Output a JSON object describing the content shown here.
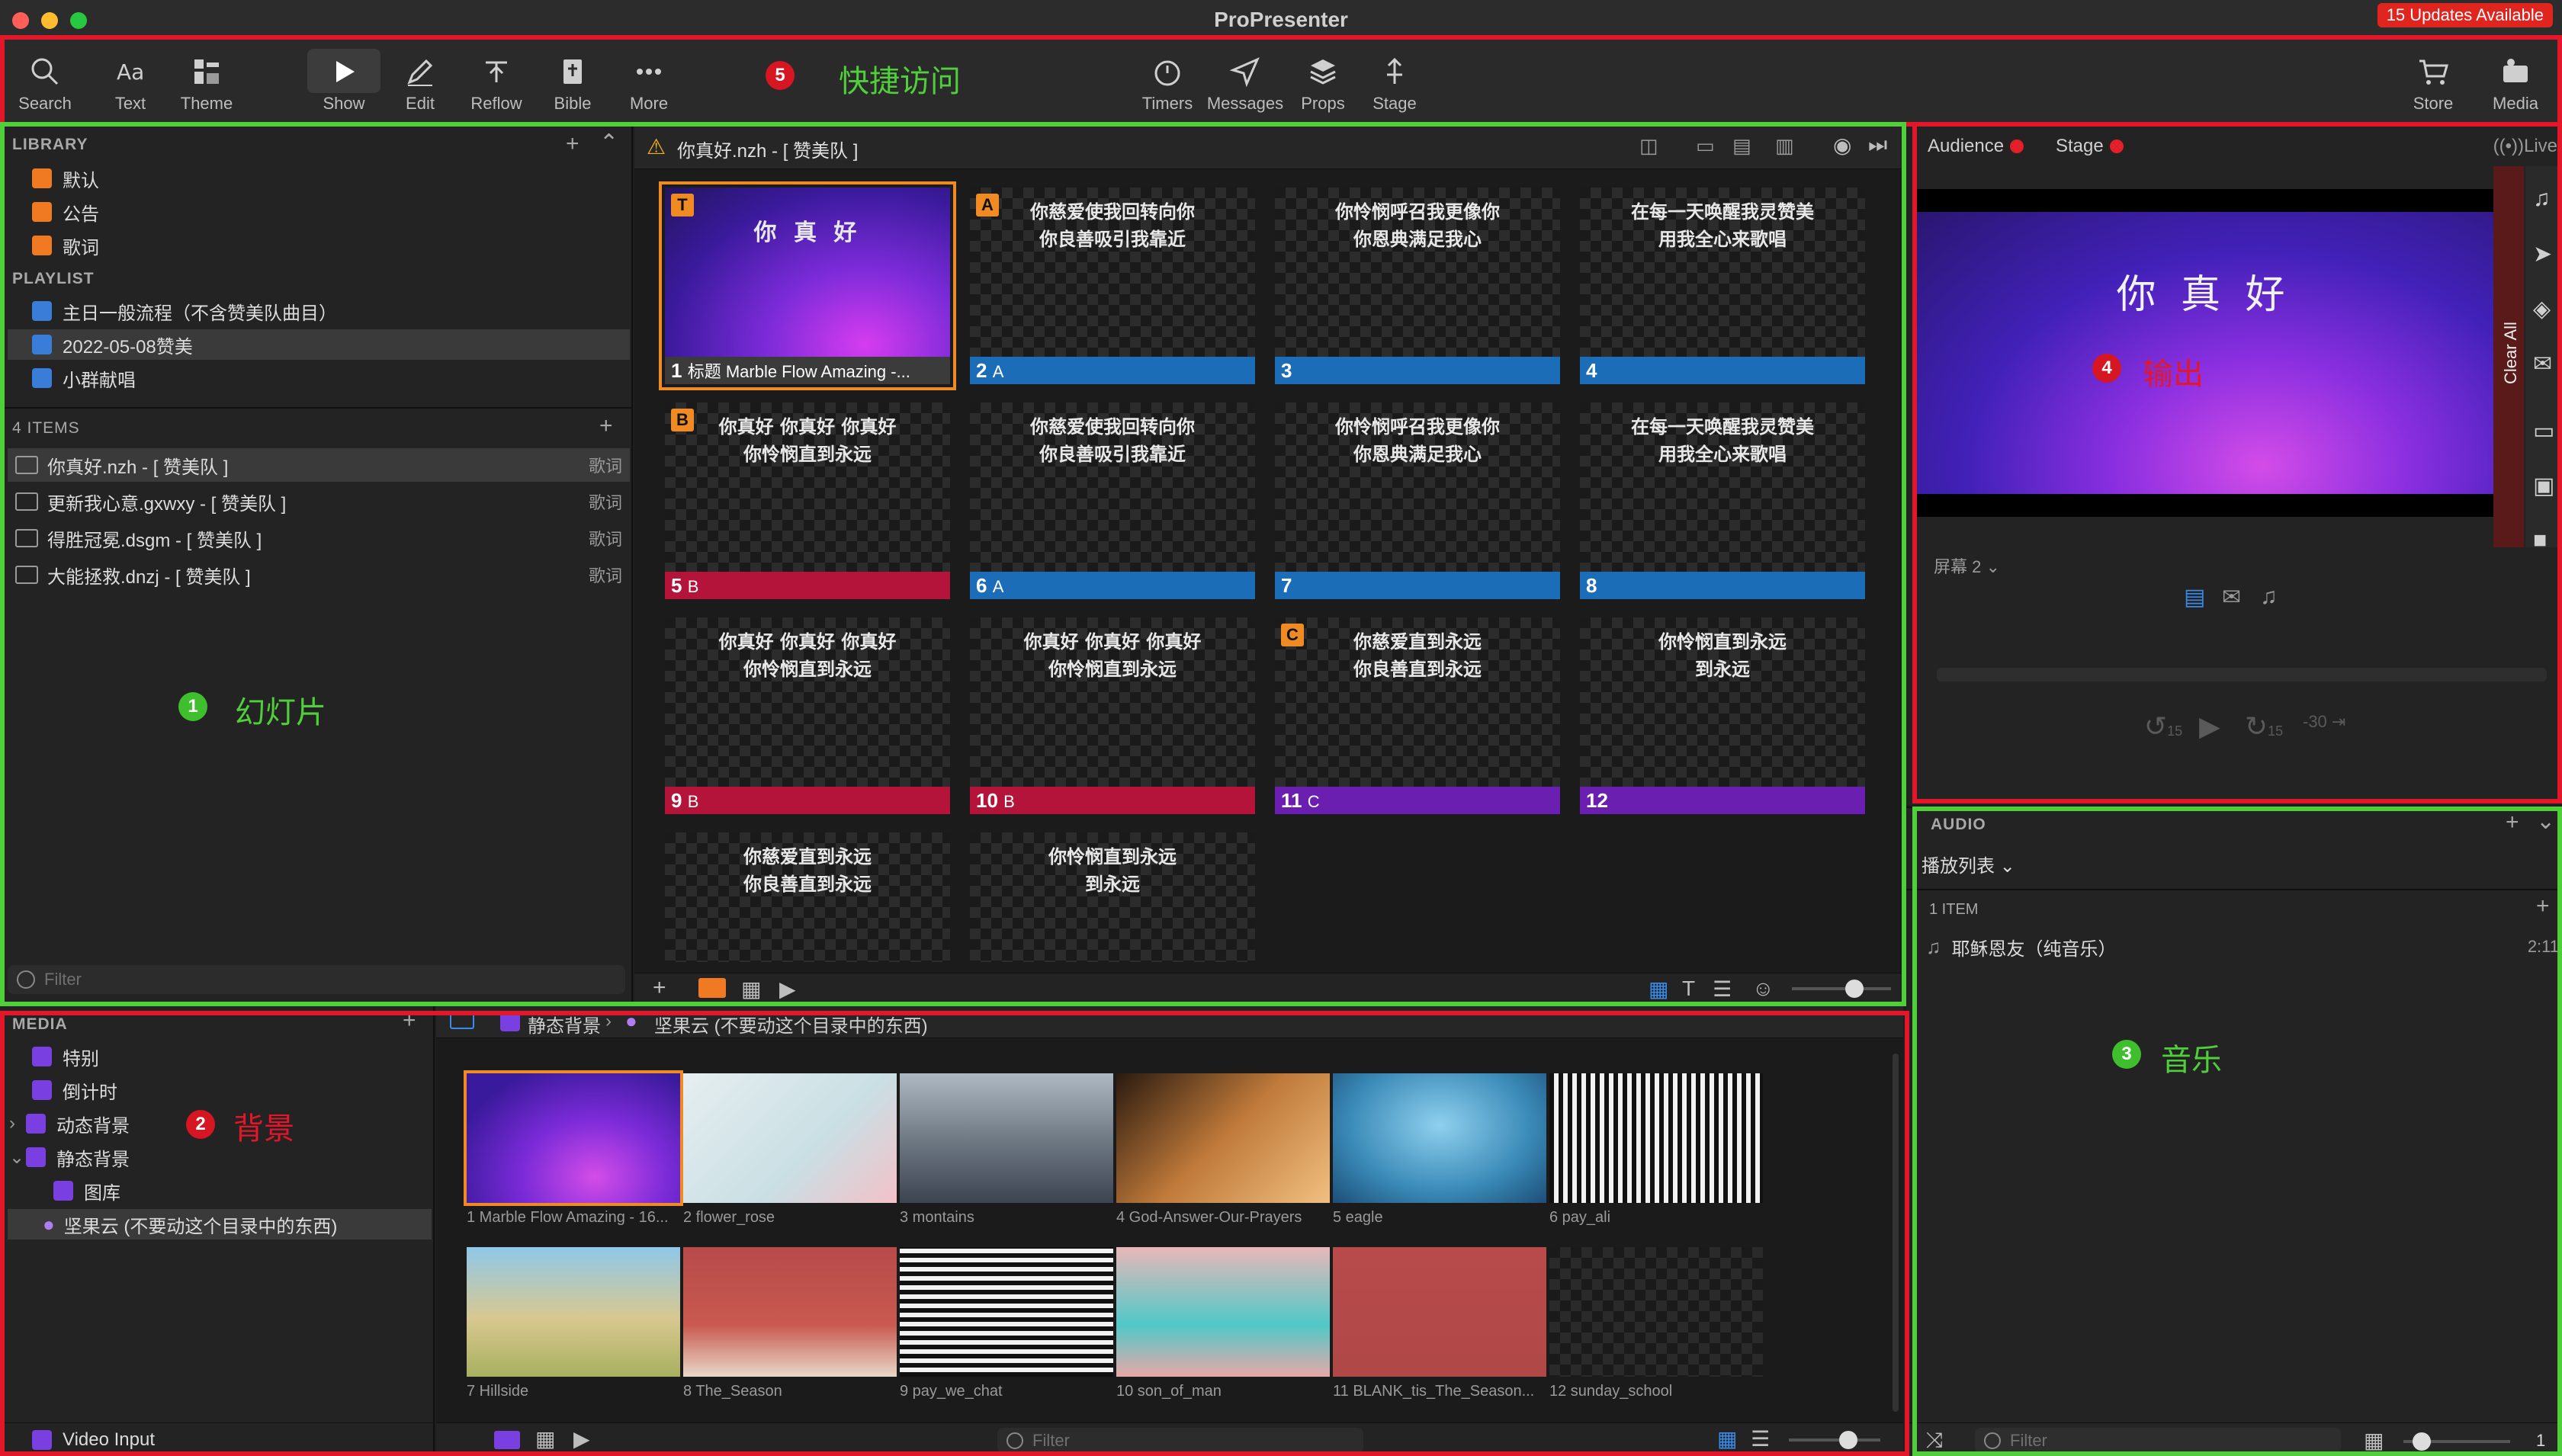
{
  "window": {
    "title": "ProPresenter",
    "updates": "15 Updates Available"
  },
  "toolbar": {
    "left": [
      "Search",
      "Text",
      "Theme"
    ],
    "center": [
      "Show",
      "Edit",
      "Reflow",
      "Bible",
      "More"
    ],
    "right": [
      "Timers",
      "Messages",
      "Props",
      "Stage"
    ],
    "far_right": [
      "Store",
      "Media"
    ]
  },
  "annotations": {
    "a1": {
      "num": "1",
      "label": "幻灯片"
    },
    "a2": {
      "num": "2",
      "label": "背景"
    },
    "a3": {
      "num": "3",
      "label": "音乐"
    },
    "a4": {
      "num": "4",
      "label": "输出"
    },
    "a5": {
      "num": "5",
      "label": "快捷访问"
    }
  },
  "library": {
    "header": "LIBRARY",
    "items": [
      "默认",
      "公告",
      "歌词"
    ],
    "playlist_header": "PLAYLIST",
    "playlists": [
      "主日一般流程（不含赞美队曲目）",
      "2022-05-08赞美",
      "小群献唱"
    ]
  },
  "items": {
    "count": "4 ITEMS",
    "rows": [
      {
        "name": "你真好.nzh - [ 赞美队 ]",
        "tag": "歌词"
      },
      {
        "name": "更新我心意.gxwxy - [ 赞美队 ]",
        "tag": "歌词"
      },
      {
        "name": "得胜冠冕.dsgm - [ 赞美队 ]",
        "tag": "歌词"
      },
      {
        "name": "大能拯救.dnzj - [ 赞美队 ]",
        "tag": "歌词"
      }
    ],
    "filter": "Filter"
  },
  "presentation": {
    "title": "你真好.nzh - [ 赞美队 ]",
    "slides": [
      {
        "l1": "你 真 好",
        "l2": "",
        "num": "1",
        "label": "标题 Marble Flow Amazing -...",
        "group": "T"
      },
      {
        "l1": "你慈爱使我回转向你",
        "l2": "你良善吸引我靠近",
        "num": "2",
        "label": "A",
        "group": "A"
      },
      {
        "l1": "你怜悯呼召我更像你",
        "l2": "你恩典满足我心",
        "num": "3",
        "label": "",
        "group": ""
      },
      {
        "l1": "在每一天唤醒我灵赞美",
        "l2": "用我全心来歌唱",
        "num": "4",
        "label": "",
        "group": ""
      },
      {
        "l1": "你真好 你真好 你真好",
        "l2": "你怜悯直到永远",
        "num": "5",
        "label": "B",
        "group": "B"
      },
      {
        "l1": "你慈爱使我回转向你",
        "l2": "你良善吸引我靠近",
        "num": "6",
        "label": "A",
        "group": ""
      },
      {
        "l1": "你怜悯呼召我更像你",
        "l2": "你恩典满足我心",
        "num": "7",
        "label": "",
        "group": ""
      },
      {
        "l1": "在每一天唤醒我灵赞美",
        "l2": "用我全心来歌唱",
        "num": "8",
        "label": "",
        "group": ""
      },
      {
        "l1": "你真好 你真好 你真好",
        "l2": "你怜悯直到永远",
        "num": "9",
        "label": "B",
        "group": ""
      },
      {
        "l1": "你真好 你真好 你真好",
        "l2": "你怜悯直到永远",
        "num": "10",
        "label": "B",
        "group": ""
      },
      {
        "l1": "你慈爱直到永远",
        "l2": "你良善直到永远",
        "num": "11",
        "label": "C",
        "group": "C"
      },
      {
        "l1": "你怜悯直到永远",
        "l2": "到永远",
        "num": "12",
        "label": "",
        "group": ""
      },
      {
        "l1": "你慈爱直到永远",
        "l2": "你良善直到永远",
        "num": "",
        "label": "",
        "group": ""
      },
      {
        "l1": "你怜悯直到永远",
        "l2": "到永远",
        "num": "",
        "label": "",
        "group": ""
      }
    ]
  },
  "output": {
    "audience": "Audience",
    "stage": "Stage",
    "live": "Live",
    "preview_text": "你 真 好",
    "clear_all": "Clear All",
    "screen": "屏幕 2",
    "skip_back": "15",
    "skip_fwd": "15",
    "skip_30": "-30"
  },
  "audio": {
    "header": "AUDIO",
    "playlist": "播放列表",
    "count": "1 ITEM",
    "track": "耶稣恩友（纯音乐）",
    "duration": "2:11",
    "filter": "Filter",
    "page": "1"
  },
  "media": {
    "header": "MEDIA",
    "items": [
      "特别",
      "倒计时",
      "动态背景",
      "静态背景",
      "图库",
      "坚果云 (不要动这个目录中的东西)"
    ],
    "breadcrumb1": "静态背景",
    "breadcrumb2": "坚果云 (不要动这个目录中的东西)",
    "video_input": "Video Input",
    "filter": "Filter",
    "thumbs": [
      "1 Marble Flow Amazing - 16...",
      "2 flower_rose",
      "3 montains",
      "4 God-Answer-Our-Prayers",
      "5 eagle",
      "6 pay_ali",
      "7 Hillside",
      "8 The_Season",
      "9 pay_we_chat",
      "10 son_of_man",
      "11 BLANK_tis_The_Season...",
      "12 sunday_school"
    ]
  },
  "colors": {
    "annotation_red": "#e3162a",
    "annotation_green": "#4fcf3a",
    "group_orange": "#f08a22"
  }
}
